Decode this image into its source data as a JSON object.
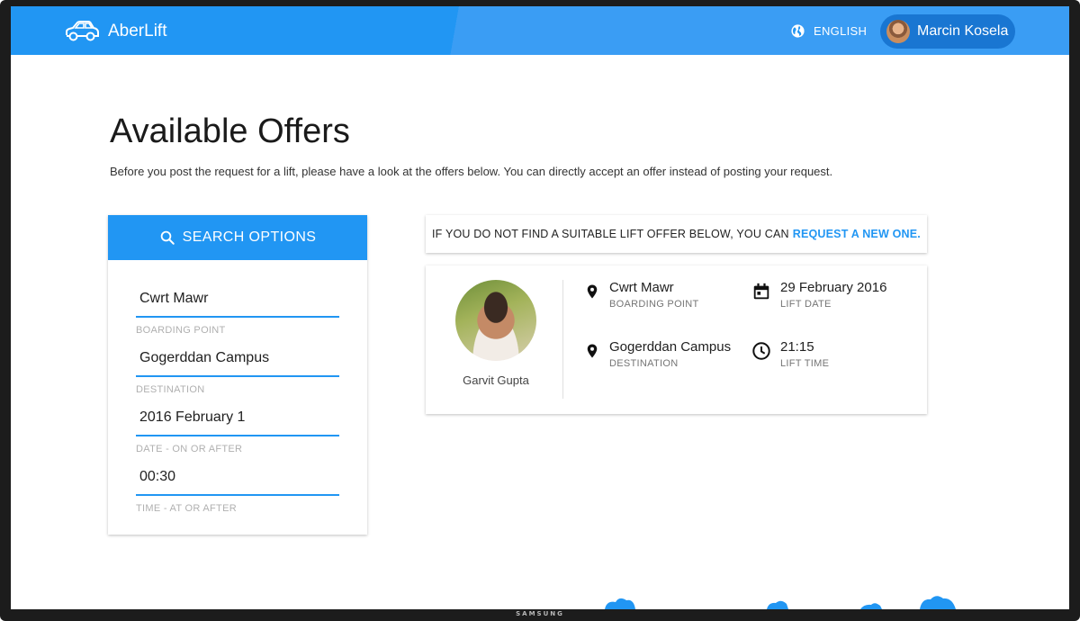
{
  "header": {
    "app_name": "AberLift",
    "language": "ENGLISH",
    "user_name": "Marcin Kosela"
  },
  "page": {
    "title": "Available Offers",
    "subtitle": "Before you post the request for a lift, please have a look at the offers below. You can directly accept an offer instead of posting your request."
  },
  "search": {
    "heading": "SEARCH OPTIONS",
    "fields": [
      {
        "value": "Cwrt Mawr",
        "label": "BOARDING POINT"
      },
      {
        "value": "Gogerddan Campus",
        "label": "DESTINATION"
      },
      {
        "value": "2016 February 1",
        "label": "DATE - ON OR AFTER"
      },
      {
        "value": "00:30",
        "label": "TIME - AT OR AFTER"
      }
    ]
  },
  "notice": {
    "text": "IF YOU DO NOT FIND A SUITABLE LIFT OFFER BELOW, YOU CAN",
    "link": "REQUEST A NEW ONE."
  },
  "offer": {
    "driver": "Garvit Gupta",
    "boarding_value": "Cwrt Mawr",
    "boarding_label": "BOARDING POINT",
    "destination_value": "Gogerddan Campus",
    "destination_label": "DESTINATION",
    "date_value": "29 February 2016",
    "date_label": "LIFT DATE",
    "time_value": "21:15",
    "time_label": "LIFT TIME"
  },
  "device": {
    "brand": "SAMSUNG"
  },
  "colors": {
    "primary": "#2196f3",
    "primary_dark": "#1976d2"
  },
  "icons": {
    "logo": "car-icon",
    "language": "globe-icon",
    "search": "search-icon",
    "location": "location-pin-icon",
    "date": "calendar-icon",
    "time": "clock-icon"
  }
}
